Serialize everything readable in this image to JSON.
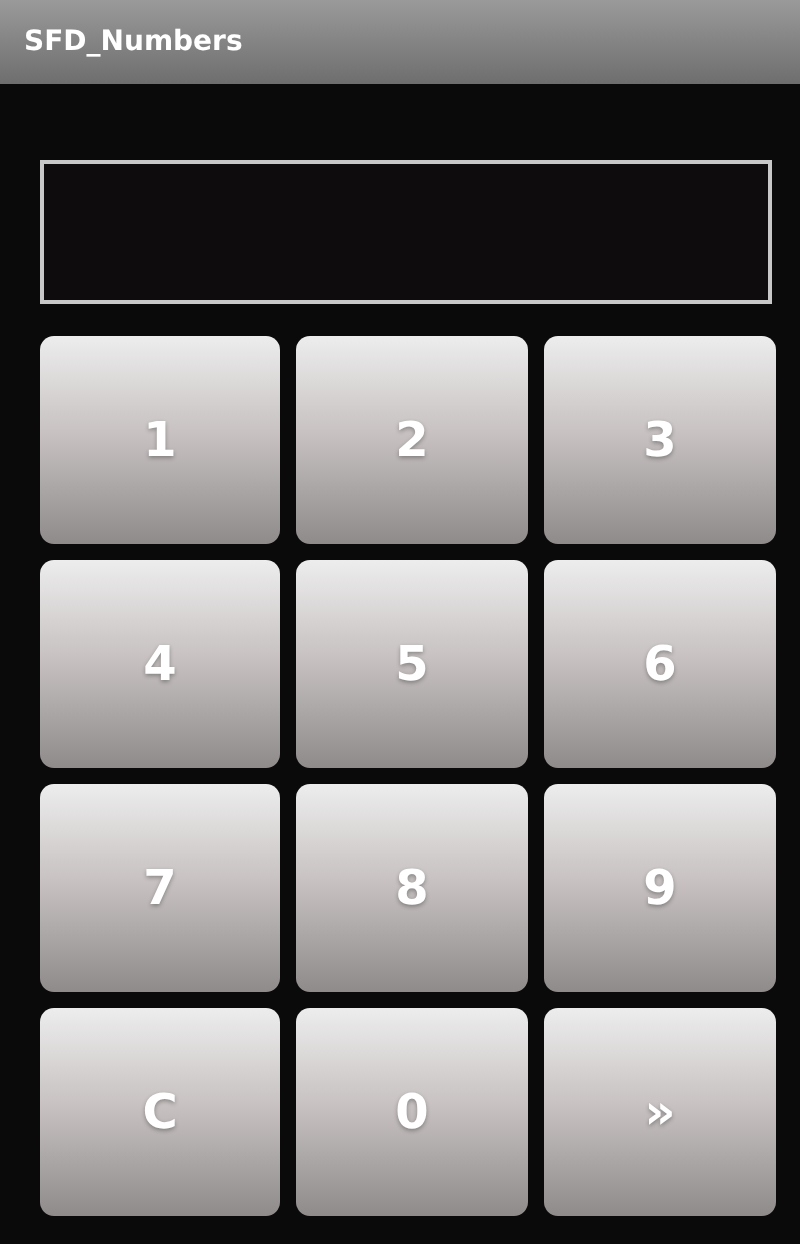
{
  "window": {
    "title": "SFD_Numbers"
  },
  "keys": [
    {
      "label": "1"
    },
    {
      "label": "2"
    },
    {
      "label": "3"
    },
    {
      "label": "4"
    },
    {
      "label": "5"
    },
    {
      "label": "6"
    },
    {
      "label": "7"
    },
    {
      "label": "8"
    },
    {
      "label": "9"
    },
    {
      "label": "C"
    },
    {
      "label": "0"
    },
    {
      "label": "»"
    }
  ]
}
